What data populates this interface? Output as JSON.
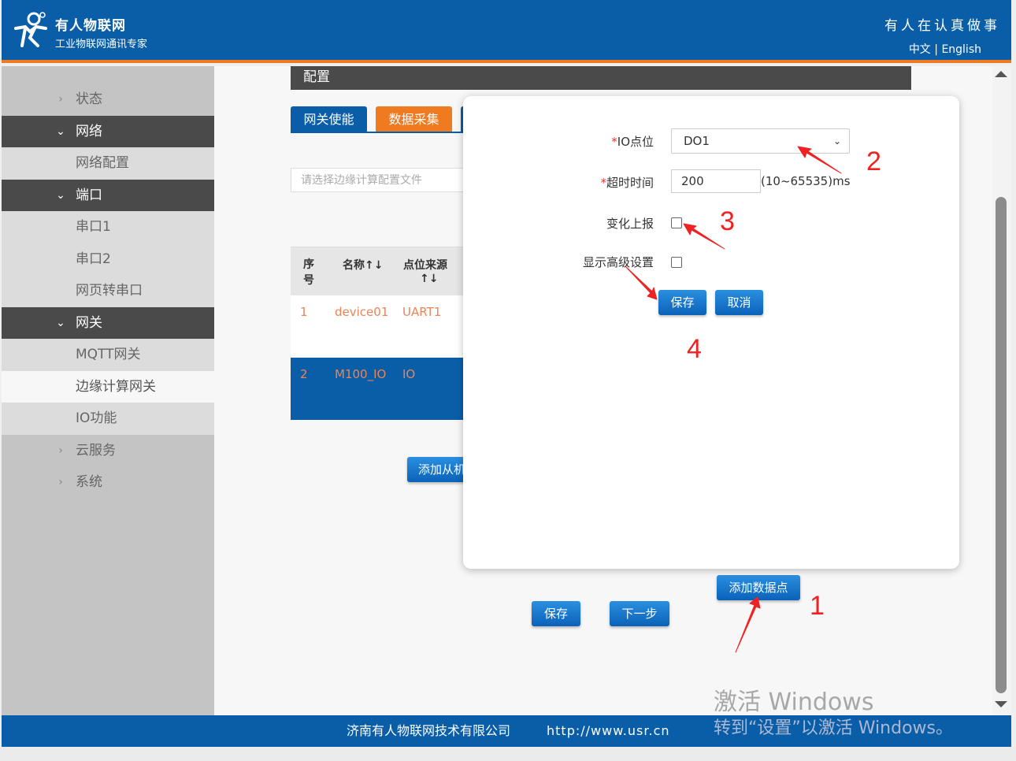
{
  "header": {
    "brand_name": "有人物联网",
    "brand_sub": "工业物联网通讯专家",
    "slogan": "有人在认真做事",
    "lang_cn": "中文",
    "lang_sep": "|",
    "lang_en": "English"
  },
  "sidebar": {
    "items": [
      {
        "label": "状态",
        "type": "top",
        "chev": "›"
      },
      {
        "label": "网络",
        "type": "group",
        "chev": "⌄"
      },
      {
        "label": "网络配置",
        "type": "sub"
      },
      {
        "label": "端口",
        "type": "group",
        "chev": "⌄"
      },
      {
        "label": "串口1",
        "type": "sub"
      },
      {
        "label": "串口2",
        "type": "sub"
      },
      {
        "label": "网页转串口",
        "type": "sub"
      },
      {
        "label": "网关",
        "type": "group",
        "chev": "⌄"
      },
      {
        "label": "MQTT网关",
        "type": "sub"
      },
      {
        "label": "边缘计算网关",
        "type": "active"
      },
      {
        "label": "IO功能",
        "type": "sub"
      },
      {
        "label": "云服务",
        "type": "top",
        "chev": "›"
      },
      {
        "label": "系统",
        "type": "top",
        "chev": "›"
      }
    ]
  },
  "main": {
    "section_title": "配置",
    "tabs": [
      {
        "label": "网关使能",
        "color": "#0a5ea8"
      },
      {
        "label": "数据采集",
        "color": "#f07a20"
      }
    ],
    "file_select_placeholder": "请选择边缘计算配置文件",
    "table": {
      "headers": {
        "index": "序号",
        "name": "名称↑↓",
        "source": "点位来源",
        "source_sort": "↑↓"
      },
      "rows": [
        {
          "index": "1",
          "name": "device01",
          "source": "UART1"
        },
        {
          "index": "2",
          "name": "M100_IO",
          "source": "IO"
        }
      ]
    },
    "add_slave_button": "添加从机",
    "add_datapoint_button": "添加数据点",
    "save_button": "保存",
    "next_button": "下一步"
  },
  "modal": {
    "io_point_label": "IO点位",
    "io_point_value": "DO1",
    "timeout_label": "超时时间",
    "timeout_value": "200",
    "timeout_hint": "(10~65535)ms",
    "change_report_label": "变化上报",
    "change_report_checked": false,
    "advanced_label": "显示高级设置",
    "advanced_checked": false,
    "save_button": "保存",
    "cancel_button": "取消",
    "required_mark": "*"
  },
  "annotations": [
    "1",
    "2",
    "3",
    "4"
  ],
  "footer": {
    "company": "济南有人物联网技术有限公司",
    "url": "http://www.usr.cn"
  },
  "watermark": {
    "line1": "激活 Windows",
    "line2": "转到“设置”以激活 Windows。"
  },
  "colors": {
    "brand_blue": "#0a5ea8",
    "accent_orange": "#f07a20",
    "annotation_red": "#e22"
  }
}
